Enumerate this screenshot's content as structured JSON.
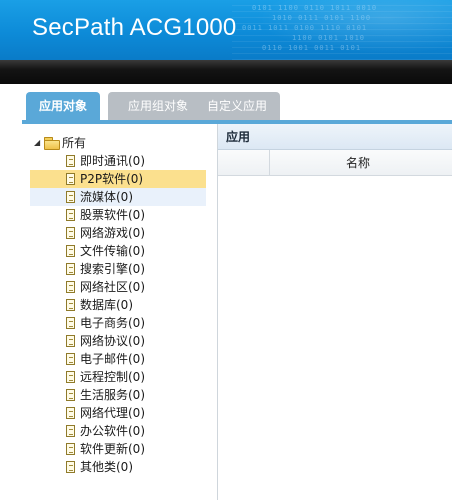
{
  "header": {
    "brand": "SecPath ACG1000"
  },
  "tabs": [
    {
      "label": "应用对象",
      "active": true
    },
    {
      "label": "应用组对象",
      "active": false
    },
    {
      "label": "自定义应用",
      "active": false
    }
  ],
  "tree": {
    "root_label": "所有",
    "items": [
      {
        "label": "即时通讯(0)"
      },
      {
        "label": "P2P软件(0)",
        "state": "selected"
      },
      {
        "label": "流媒体(0)",
        "state": "hover"
      },
      {
        "label": "股票软件(0)"
      },
      {
        "label": "网络游戏(0)"
      },
      {
        "label": "文件传输(0)"
      },
      {
        "label": "搜索引擎(0)"
      },
      {
        "label": "网络社区(0)"
      },
      {
        "label": "数据库(0)"
      },
      {
        "label": "电子商务(0)"
      },
      {
        "label": "网络协议(0)"
      },
      {
        "label": "电子邮件(0)"
      },
      {
        "label": "远程控制(0)"
      },
      {
        "label": "生活服务(0)"
      },
      {
        "label": "网络代理(0)"
      },
      {
        "label": "办公软件(0)"
      },
      {
        "label": "软件更新(0)"
      },
      {
        "label": "其他类(0)"
      }
    ]
  },
  "app_panel": {
    "title": "应用",
    "columns": [
      "",
      "名称"
    ]
  },
  "colors": {
    "header_blue": "#1a9fe6",
    "tab_active": "#5aa8d8",
    "tab_inactive": "#b8bec4",
    "selected_row": "#fbe08e"
  }
}
